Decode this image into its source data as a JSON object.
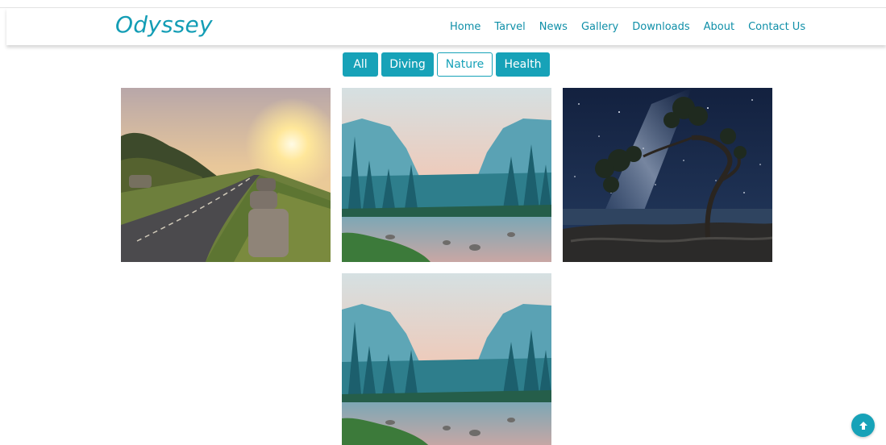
{
  "brand": {
    "name": "Odyssey"
  },
  "nav": {
    "items": [
      {
        "label": "Home"
      },
      {
        "label": "Tarvel"
      },
      {
        "label": "News"
      },
      {
        "label": "Gallery"
      },
      {
        "label": "Downloads"
      },
      {
        "label": "About"
      },
      {
        "label": "Contact Us"
      }
    ]
  },
  "filters": {
    "items": [
      {
        "label": "All",
        "active": false
      },
      {
        "label": "Diving",
        "active": false
      },
      {
        "label": "Nature",
        "active": true
      },
      {
        "label": "Health",
        "active": false
      }
    ]
  },
  "gallery": {
    "photos": [
      {
        "subject": "sunrise-road"
      },
      {
        "subject": "valley-river"
      },
      {
        "subject": "milky-way-tree"
      },
      {
        "subject": "valley-river"
      }
    ]
  },
  "back_to_top": {
    "icon": "arrow-up-icon"
  },
  "colors": {
    "accent": "#17a2b8",
    "brand": "#139db5",
    "nav": "#0f8fa8"
  }
}
